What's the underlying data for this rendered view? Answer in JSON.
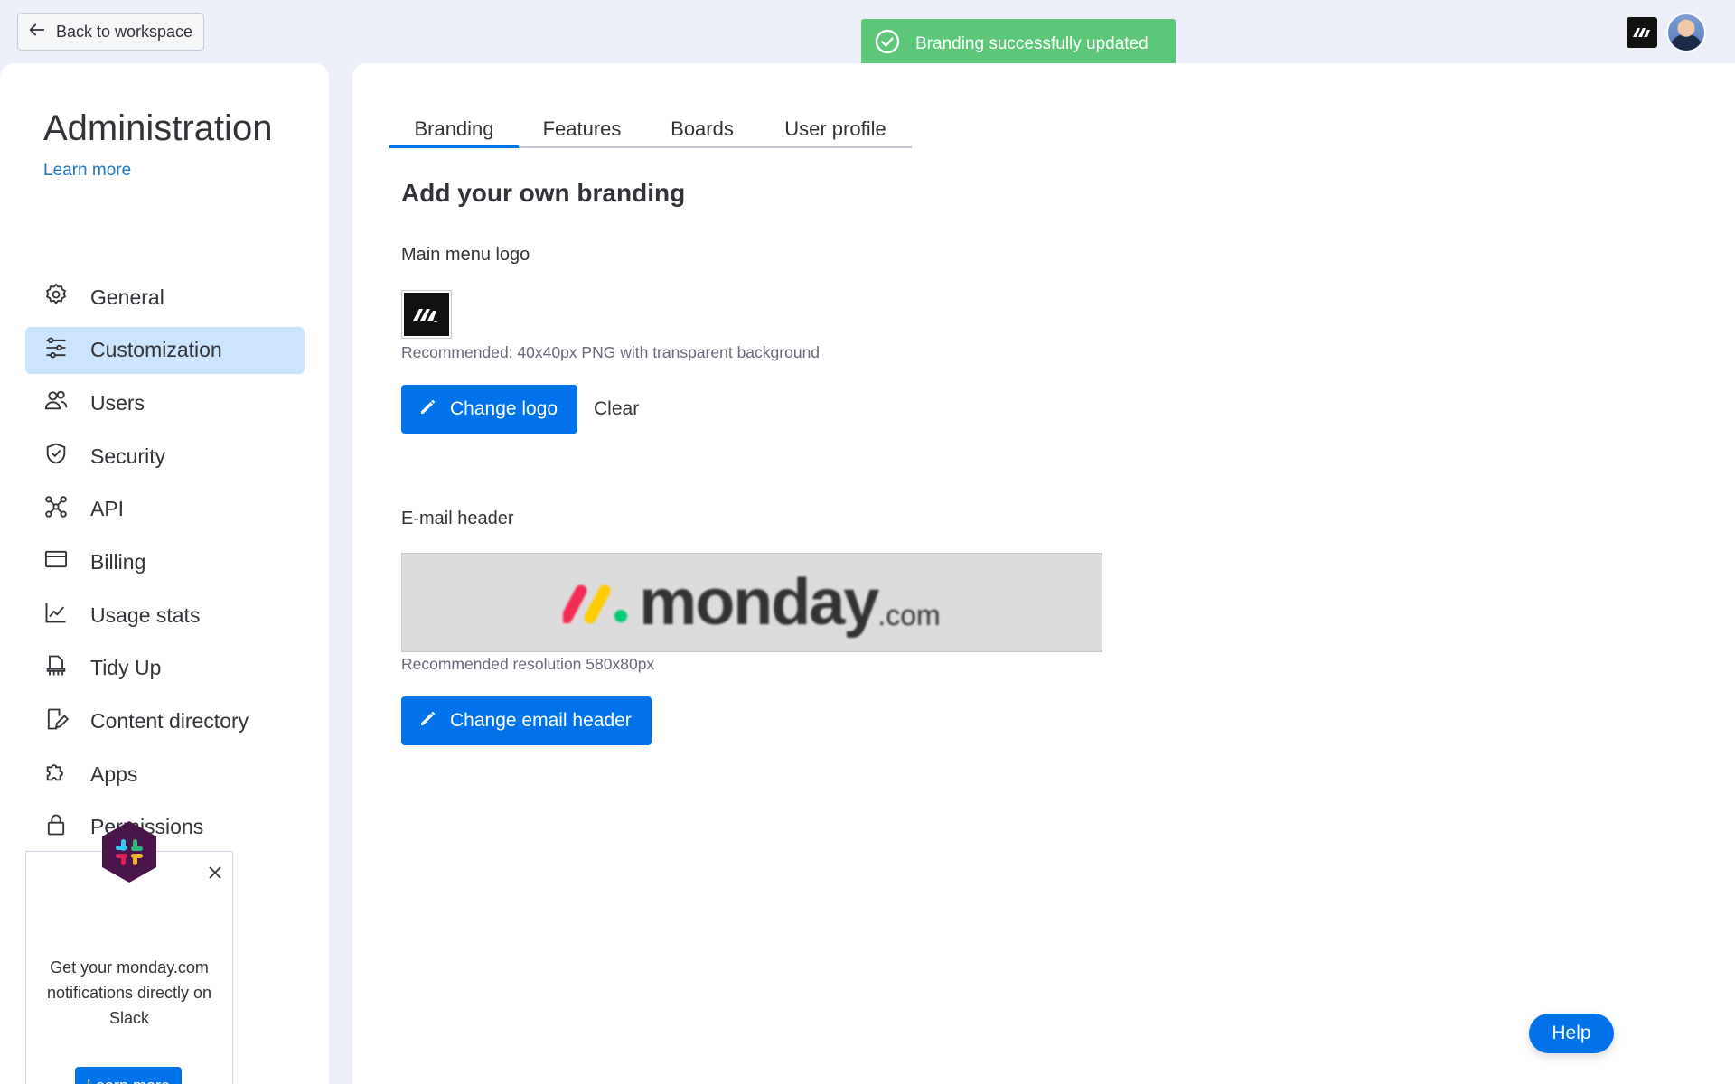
{
  "topbar": {
    "back_label": "Back to workspace",
    "toast_text": "Branding successfully updated",
    "toast_color": "#5bc777"
  },
  "sidebar": {
    "title": "Administration",
    "learn_more": "Learn more",
    "items": [
      {
        "label": "General",
        "icon": "gear-icon"
      },
      {
        "label": "Customization",
        "icon": "sliders-icon",
        "active": true
      },
      {
        "label": "Users",
        "icon": "users-icon"
      },
      {
        "label": "Security",
        "icon": "shield-icon"
      },
      {
        "label": "API",
        "icon": "api-icon"
      },
      {
        "label": "Billing",
        "icon": "credit-card-icon"
      },
      {
        "label": "Usage stats",
        "icon": "chart-icon"
      },
      {
        "label": "Tidy Up",
        "icon": "broom-icon"
      },
      {
        "label": "Content directory",
        "icon": "document-icon"
      },
      {
        "label": "Apps",
        "icon": "puzzle-icon"
      },
      {
        "label": "Permissions",
        "icon": "lock-icon"
      }
    ],
    "slack_card": {
      "text": "Get your monday.com notifications directly on Slack",
      "button": "Learn more"
    }
  },
  "main": {
    "tabs": [
      {
        "label": "Branding",
        "active": true
      },
      {
        "label": "Features"
      },
      {
        "label": "Boards"
      },
      {
        "label": "User profile"
      }
    ],
    "section_title": "Add your own branding",
    "logo": {
      "label": "Main menu logo",
      "hint": "Recommended: 40x40px PNG with transparent background",
      "change_button": "Change logo",
      "clear_button": "Clear"
    },
    "email": {
      "label": "E-mail header",
      "wordmark": "monday",
      "wordmark_suffix": ".com",
      "hint": "Recommended resolution 580x80px",
      "change_button": "Change email header"
    },
    "help_button": "Help"
  },
  "colors": {
    "accent": "#0073ea",
    "active_nav_bg": "#cce5ff",
    "link": "#1f76c2"
  }
}
